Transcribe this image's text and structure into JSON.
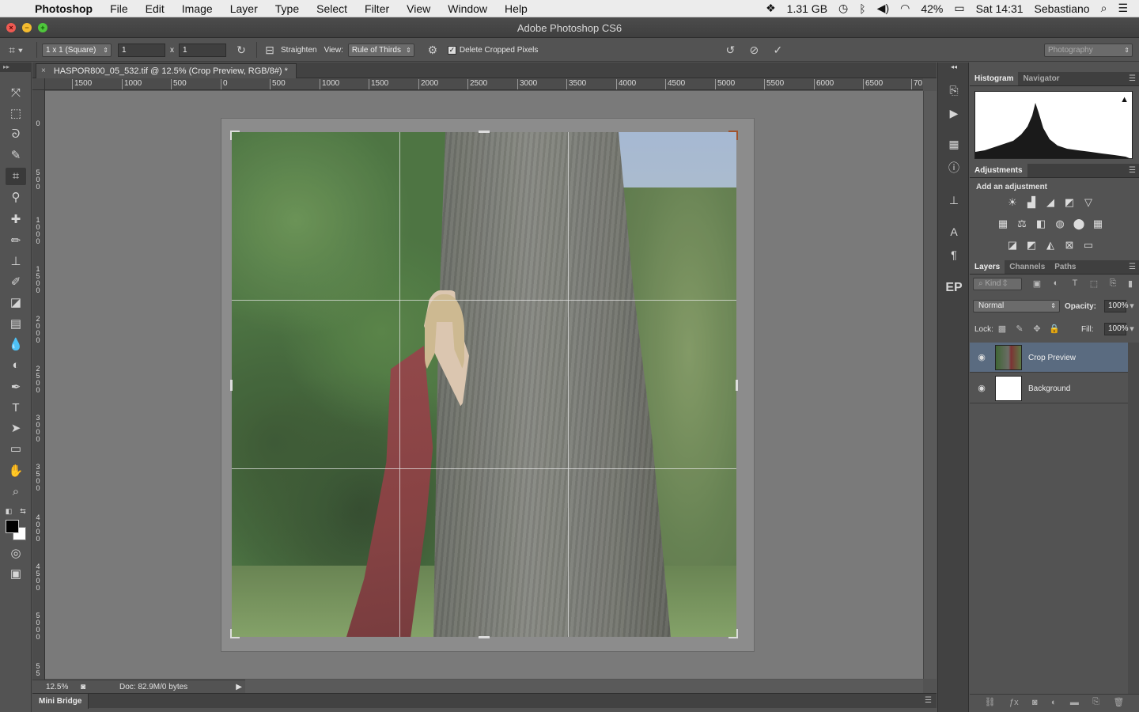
{
  "menubar": {
    "app_name": "Photoshop",
    "items": [
      "File",
      "Edit",
      "Image",
      "Layer",
      "Type",
      "Select",
      "Filter",
      "View",
      "Window",
      "Help"
    ],
    "memory": "1.31 GB",
    "battery": "42%",
    "clock": "Sat 14:31",
    "user": "Sebastiano"
  },
  "window": {
    "title": "Adobe Photoshop CS6"
  },
  "options": {
    "ratio_preset": "1 x 1 (Square)",
    "ratio_width": "1",
    "ratio_x": "x",
    "ratio_height": "1",
    "straighten_label": "Straighten",
    "view_label": "View:",
    "view_value": "Rule of Thirds",
    "delete_cropped_label": "Delete Cropped Pixels",
    "delete_cropped_checked": true,
    "workspace": "Photography"
  },
  "document": {
    "tab_title": "HASPOR800_05_532.tif @ 12.5% (Crop Preview, RGB/8#) *",
    "ruler_h": [
      "1500",
      "1000",
      "500",
      "0",
      "500",
      "1000",
      "1500",
      "2000",
      "2500",
      "3000",
      "3500",
      "4000",
      "4500",
      "5000",
      "5500",
      "6000",
      "6500",
      "70"
    ],
    "ruler_v": [
      "0",
      "500",
      "1000",
      "1500",
      "2000",
      "2500",
      "3000",
      "3500",
      "4000",
      "4500",
      "5000",
      "55"
    ],
    "zoom": "12.5%",
    "doc_info": "Doc: 82.9M/0 bytes"
  },
  "minibridge": {
    "label": "Mini Bridge"
  },
  "panels": {
    "histogram_tabs": [
      "Histogram",
      "Navigator"
    ],
    "adjustments_tab": "Adjustments",
    "adjustments_hint": "Add an adjustment",
    "layers_tabs": [
      "Layers",
      "Channels",
      "Paths"
    ],
    "filter_kind": "Kind",
    "blend_mode": "Normal",
    "opacity_label": "Opacity:",
    "opacity_value": "100%",
    "lock_label": "Lock:",
    "fill_label": "Fill:",
    "fill_value": "100%",
    "layers": [
      {
        "name": "Crop Preview",
        "selected": true
      },
      {
        "name": "Background",
        "selected": false
      }
    ]
  },
  "colors": {
    "accent_selected": "#5a6b80",
    "close": "#ee5a52",
    "minimize": "#f4bb2f",
    "zoom": "#4fc63c"
  }
}
